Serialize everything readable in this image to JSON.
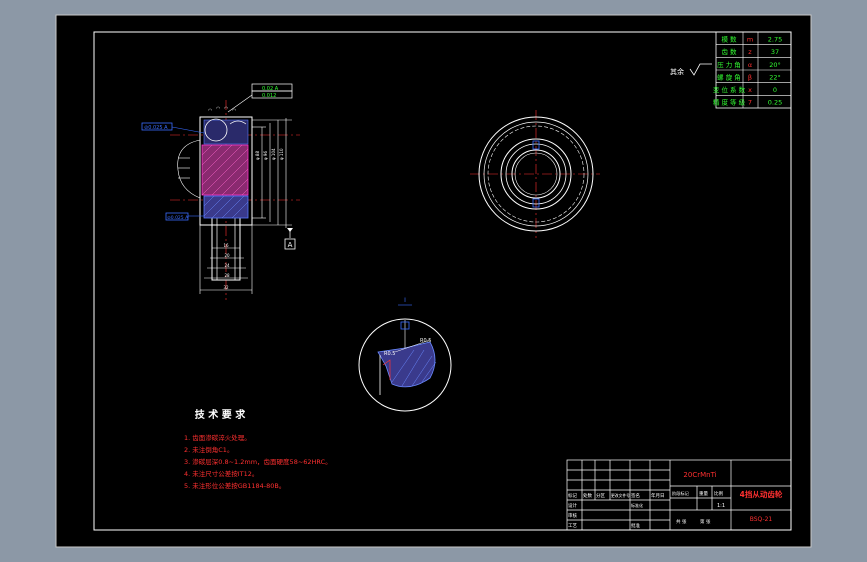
{
  "colors": {
    "background_outer": "#8c98a6",
    "sheet": "#000000",
    "line_white": "#ffffff",
    "red": "#ff3030",
    "green": "#33ff33",
    "blue": "#3a6cff",
    "magenta": "#ff33cc",
    "part_fill": "#3a3a8c"
  },
  "spec_table": {
    "rows": [
      {
        "name": "模 数",
        "symbol": "m",
        "value": "2.75"
      },
      {
        "name": "齿 数",
        "symbol": "z",
        "value": "37"
      },
      {
        "name": "压 力 角",
        "symbol": "α",
        "value": "20°"
      },
      {
        "name": "螺 旋 角",
        "symbol": "β",
        "value": "22°"
      },
      {
        "name": "变 位 系 数",
        "symbol": "x",
        "value": "0"
      },
      {
        "name": "精 度 等 级",
        "symbol": "7",
        "value": "0.25"
      }
    ]
  },
  "roughness_note": "其余",
  "datum_label": "A",
  "detail_label": "I",
  "detail_dims": [
    "R0.5",
    "R0.5"
  ],
  "section_callouts": [
    "⊘0.025 A",
    "⊘0.025 A"
  ],
  "top_tolerance": [
    "0.02 A",
    "0.012"
  ],
  "tech_requirements": {
    "title": "技 术 要 求",
    "items": [
      "1. 齿面渗碳淬火处理。",
      "2. 未注倒角C1。",
      "3. 渗碳层深0.8~1.2mm，齿面硬度58~62HRC。",
      "4. 未注尺寸公差按IT12。",
      "5. 未注形位公差按GB1184-80B。"
    ]
  },
  "title_block": {
    "material": "20CrMnTi",
    "part_name": "4挡从动齿轮",
    "drawing_no": "BSQ-21",
    "scale": "1:1",
    "labels": [
      "标记",
      "处数",
      "分区",
      "更改文件号",
      "签名",
      "年月日",
      "设计",
      "标准化",
      "审核",
      "工艺",
      "批准",
      "阶段标记",
      "重量",
      "比例",
      "共 张",
      "第 张"
    ]
  }
}
